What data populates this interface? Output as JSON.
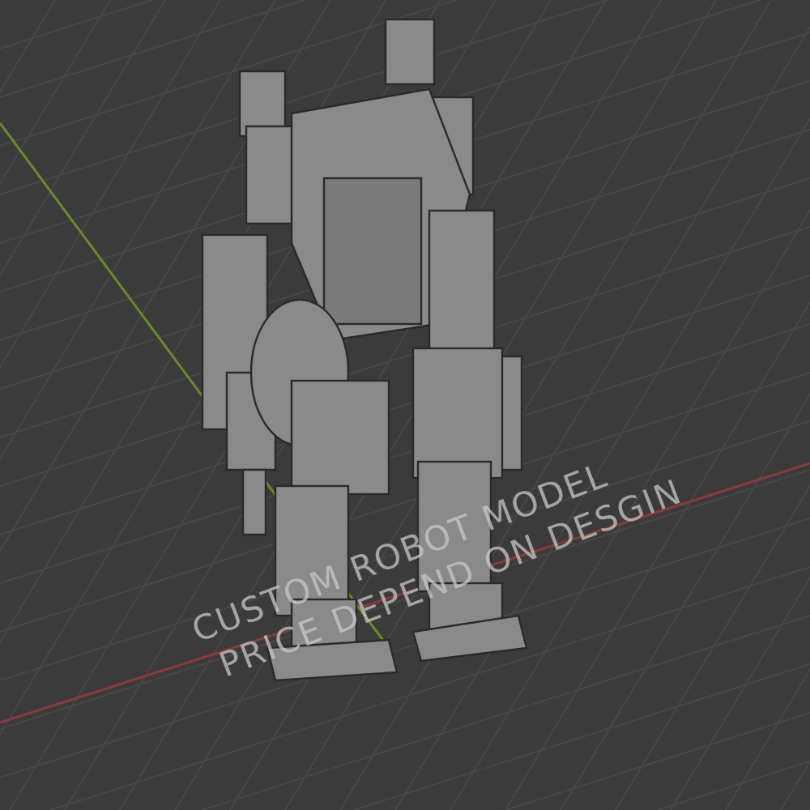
{
  "viewport": {
    "caption_lines": [
      "CUSTOM ROBOT MODEL",
      "PRICE DEPEND ON DESGIN"
    ]
  }
}
